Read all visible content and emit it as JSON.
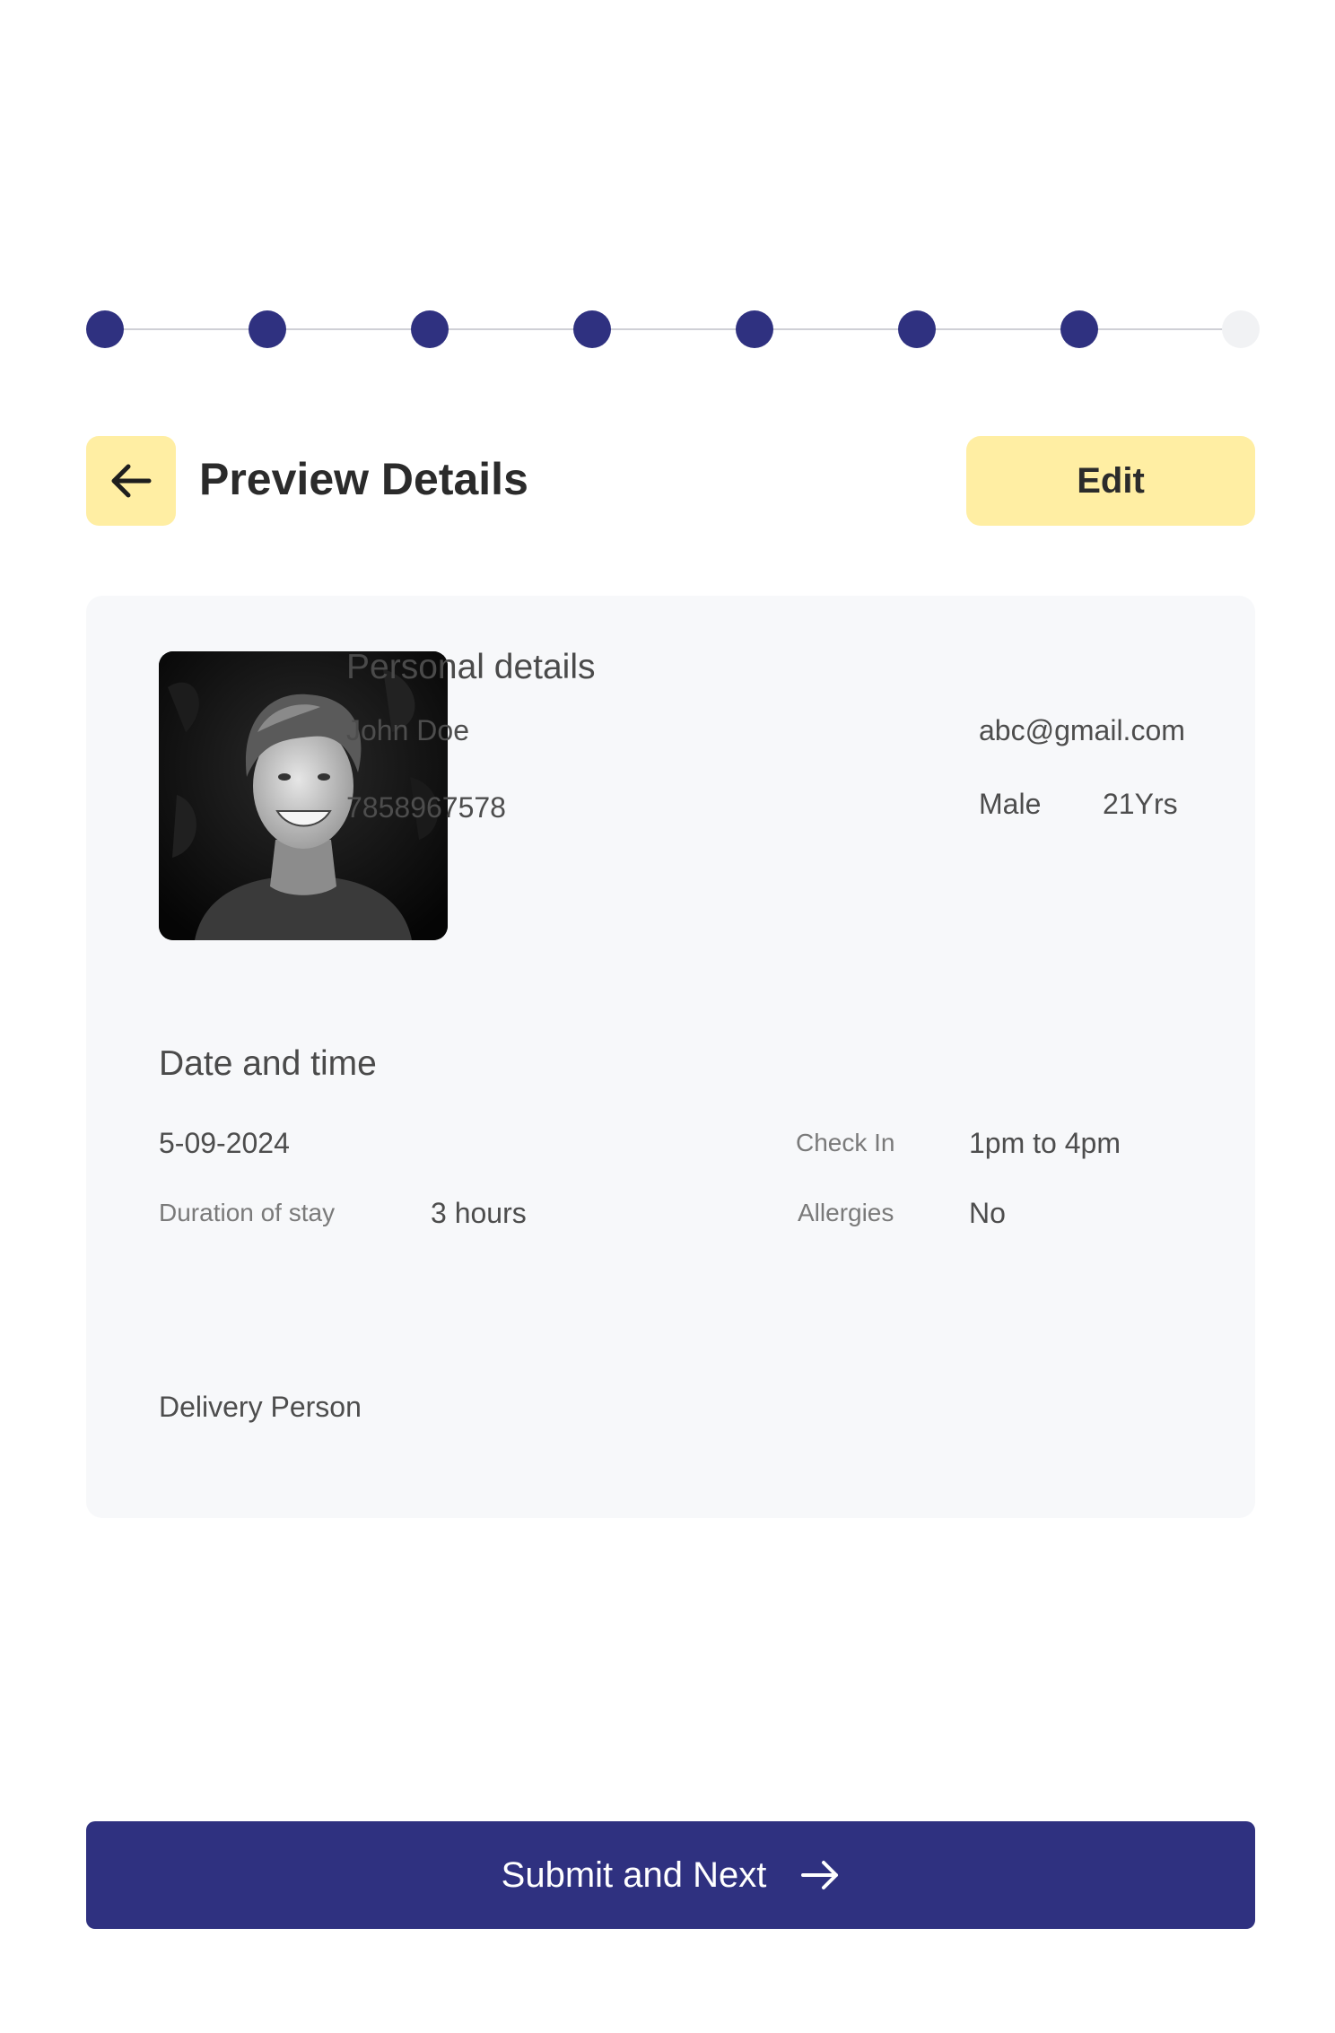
{
  "stepper": {
    "total_steps": 8,
    "completed_steps": 7,
    "colors": {
      "completed": "#2f3180",
      "pending": "#f1f2f4",
      "line": "#cfd0d6"
    }
  },
  "header": {
    "back_icon": "arrow-left-icon",
    "title": "Preview Details",
    "edit_label": "Edit",
    "accent": "#ffeea3"
  },
  "personal": {
    "section_title": "Personal details",
    "name": "John Doe",
    "email": "abc@gmail.com",
    "phone": "7858967578",
    "gender": "Male",
    "age": "21Yrs"
  },
  "date_time": {
    "section_title": "Date and time",
    "date": "5-09-2024",
    "check_in_label": "Check In",
    "check_in_value": "1pm to 4pm",
    "duration_label": "Duration of stay",
    "duration_value": "3 hours",
    "allergies_label": "Allergies",
    "allergies_value": "No"
  },
  "delivery": {
    "label": "Delivery Person"
  },
  "footer": {
    "submit_label": "Submit and Next",
    "submit_icon": "arrow-right-icon",
    "submit_color": "#2f3180"
  }
}
